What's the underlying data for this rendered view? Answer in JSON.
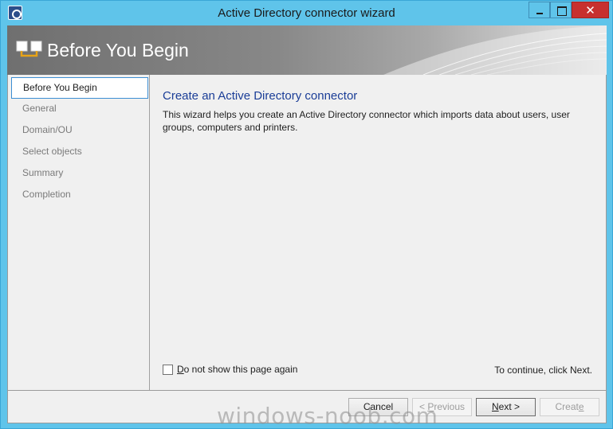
{
  "window": {
    "title": "Active Directory connector wizard",
    "close_glyph": "✕"
  },
  "banner": {
    "title": "Before You Begin"
  },
  "nav": {
    "items": [
      {
        "label": "Before You Begin",
        "active": true
      },
      {
        "label": "General",
        "active": false
      },
      {
        "label": "Domain/OU",
        "active": false
      },
      {
        "label": "Select objects",
        "active": false
      },
      {
        "label": "Summary",
        "active": false
      },
      {
        "label": "Completion",
        "active": false
      }
    ]
  },
  "content": {
    "heading": "Create an Active Directory connector",
    "description": "This wizard helps you create an Active Directory connector which imports data about users, user groups, computers and printers.",
    "checkbox_hotkey": "D",
    "checkbox_rest": "o not show this page again",
    "checkbox_checked": false,
    "continue_text": "To continue, click Next."
  },
  "footer": {
    "cancel": "Cancel",
    "previous_prefix": "< ",
    "previous_hotkey": "P",
    "previous_rest": "revious",
    "next_hotkey": "N",
    "next_rest": "ext >",
    "create_prefix": "Creat",
    "create_hotkey": "e"
  },
  "watermark": "windows-noob.com",
  "colors": {
    "titlebar": "#5fc4ea",
    "close_button": "#c7302f",
    "heading": "#1a3d97",
    "nav_active_border": "#3c8ed3"
  },
  "icons": {
    "app": "wizard-app-icon",
    "banner": "connector-icon"
  }
}
